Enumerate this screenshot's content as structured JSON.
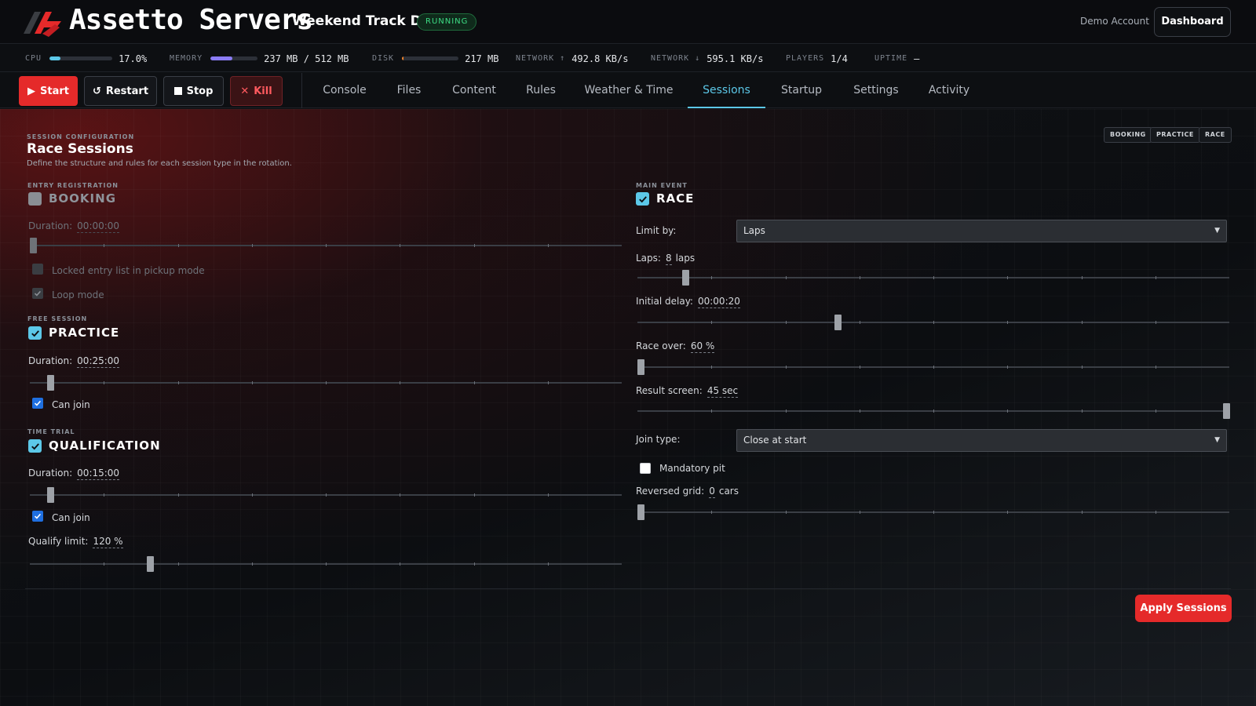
{
  "header": {
    "brand": "Assetto Servers",
    "server_name": "Weekend Track Day",
    "status": "RUNNING",
    "account": "Demo Account",
    "dashboard_label": "Dashboard",
    "accent": "#e52a2a"
  },
  "metrics": {
    "cpu": {
      "label": "CPU",
      "value": "17.0%",
      "fill": 0.17,
      "color": "#5cc8e8"
    },
    "memory": {
      "label": "MEMORY",
      "value": "237 MB / 512 MB",
      "fill": 0.46,
      "color": "#8b7cf6"
    },
    "disk": {
      "label": "DISK",
      "value": "217 MB",
      "fill": 0.03,
      "color": "#f0832a"
    },
    "net_up": {
      "label": "NETWORK ↑",
      "value": "492.8 KB/s"
    },
    "net_down": {
      "label": "NETWORK ↓",
      "value": "595.1 KB/s"
    },
    "players": {
      "label": "PLAYERS",
      "value": "1/4"
    },
    "uptime": {
      "label": "UPTIME",
      "value": "—"
    }
  },
  "controls": {
    "start": "Start",
    "restart": "Restart",
    "stop": "Stop",
    "kill": "Kill"
  },
  "tabs": [
    {
      "label": "Console"
    },
    {
      "label": "Files"
    },
    {
      "label": "Content"
    },
    {
      "label": "Rules"
    },
    {
      "label": "Weather & Time"
    },
    {
      "label": "Sessions",
      "active": true
    },
    {
      "label": "Startup"
    },
    {
      "label": "Settings"
    },
    {
      "label": "Activity"
    }
  ],
  "page": {
    "kicker": "SESSION CONFIGURATION",
    "title": "Race Sessions",
    "description": "Define the structure and rules for each session type in the rotation.",
    "chips": [
      "BOOKING",
      "PRACTICE",
      "RACE"
    ]
  },
  "booking": {
    "kicker": "ENTRY REGISTRATION",
    "name": "BOOKING",
    "enabled": false,
    "duration_label": "Duration:",
    "duration": "00:00:00",
    "duration_fraction": 0.0,
    "locked_entry_label": "Locked entry list in pickup mode",
    "loop_mode_label": "Loop mode"
  },
  "practice": {
    "kicker": "FREE SESSION",
    "name": "PRACTICE",
    "enabled": true,
    "duration_label": "Duration:",
    "duration": "00:25:00",
    "duration_fraction": 0.03,
    "can_join_label": "Can join"
  },
  "qualification": {
    "kicker": "TIME TRIAL",
    "name": "QUALIFICATION",
    "enabled": true,
    "duration_label": "Duration:",
    "duration": "00:15:00",
    "duration_fraction": 0.03,
    "can_join_label": "Can join",
    "qualify_limit_label": "Qualify limit:",
    "qualify_limit": "120 %",
    "qualify_limit_fraction": 0.2
  },
  "race": {
    "kicker": "MAIN EVENT",
    "name": "RACE",
    "enabled": true,
    "limit_by_label": "Limit by:",
    "limit_by": "Laps",
    "laps_label": "Laps:",
    "laps": "8",
    "laps_unit": "laps",
    "laps_fraction": 0.077,
    "initial_delay_label": "Initial delay:",
    "initial_delay": "00:00:20",
    "initial_delay_fraction": 0.336,
    "race_over_label": "Race over:",
    "race_over": "60 %",
    "race_over_fraction": 0.0,
    "result_screen_label": "Result screen:",
    "result_screen": "45 sec",
    "result_screen_fraction": 1.0,
    "join_type_label": "Join type:",
    "join_type": "Close at start",
    "mandatory_pit_label": "Mandatory pit",
    "reversed_grid_label": "Reversed grid:",
    "reversed_grid": "0",
    "reversed_grid_unit": "cars",
    "reversed_grid_fraction": 0.0
  },
  "apply_label": "Apply Sessions"
}
